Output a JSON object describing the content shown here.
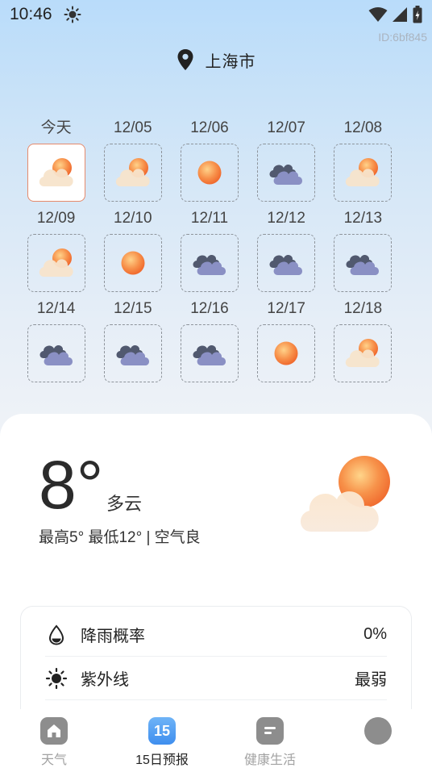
{
  "status_bar": {
    "time": "10:46"
  },
  "page_id": "ID:6bf845",
  "location": {
    "city": "上海市"
  },
  "forecast": [
    {
      "date": "今天",
      "icon": "partly-cloudy-icon",
      "selected": true
    },
    {
      "date": "12/05",
      "icon": "partly-cloudy-icon"
    },
    {
      "date": "12/06",
      "icon": "sunny-icon"
    },
    {
      "date": "12/07",
      "icon": "cloudy-icon"
    },
    {
      "date": "12/08",
      "icon": "partly-cloudy-icon"
    },
    {
      "date": "12/09",
      "icon": "partly-cloudy-icon"
    },
    {
      "date": "12/10",
      "icon": "sunny-icon"
    },
    {
      "date": "12/11",
      "icon": "cloudy-icon"
    },
    {
      "date": "12/12",
      "icon": "cloudy-icon"
    },
    {
      "date": "12/13",
      "icon": "cloudy-icon"
    },
    {
      "date": "12/14",
      "icon": "cloudy-icon"
    },
    {
      "date": "12/15",
      "icon": "cloudy-icon"
    },
    {
      "date": "12/16",
      "icon": "cloudy-icon"
    },
    {
      "date": "12/17",
      "icon": "sunny-icon"
    },
    {
      "date": "12/18",
      "icon": "partly-cloudy-icon"
    }
  ],
  "current": {
    "temperature": "8°",
    "condition": "多云",
    "range_text": "最高5° 最低12° | 空气良",
    "icon": "partly-cloudy-icon"
  },
  "details": {
    "rain_label": "降雨概率",
    "rain_value": "0%",
    "uv_label": "紫外线",
    "uv_value": "最弱"
  },
  "bottom_nav": {
    "weather_label": "天气",
    "forecast_label": "15日预报",
    "forecast_badge": "15",
    "health_label": "健康生活"
  },
  "colors": {
    "accent_border": "#e58a6c",
    "forecast_badge": "#4f9df3",
    "sun": "#f3773e",
    "cloud": "#f6e2c6",
    "dark_cloud": "#6c75a6"
  }
}
